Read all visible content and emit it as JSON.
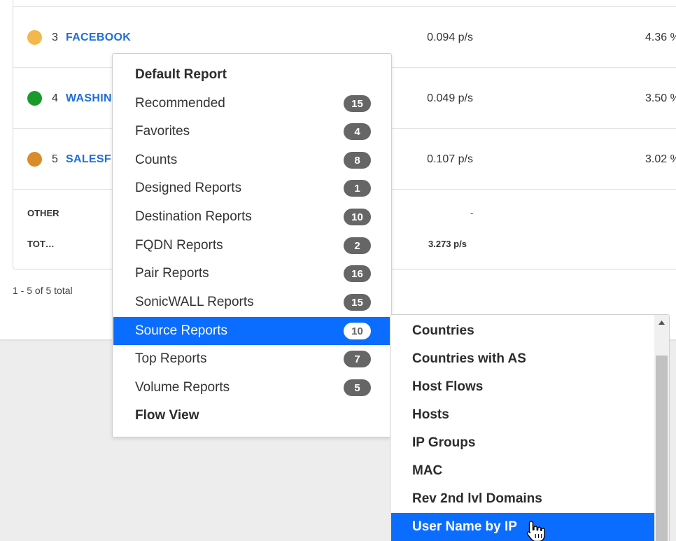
{
  "table": {
    "rows": [
      {
        "rank": "3",
        "name": "FACEBOOK",
        "rate": "0.094 p/s",
        "percent": "4.36 %",
        "dot_color": "#f2b84b"
      },
      {
        "rank": "4",
        "name": "WASHIN",
        "rate": "0.049 p/s",
        "percent": "3.50 %",
        "dot_color": "#1a9a2b"
      },
      {
        "rank": "5",
        "name": "SALESF",
        "rate": "0.107 p/s",
        "percent": "3.02 %",
        "dot_color": "#d98c2b"
      }
    ],
    "other_label": "OTHER",
    "other_rate": "-",
    "total_label": "TOT…",
    "total_rate": "3.273 p/s",
    "footer": "1 - 5 of 5 total"
  },
  "menu": {
    "items": [
      {
        "label": "Default Report",
        "badge": null,
        "type": "header"
      },
      {
        "label": "Recommended",
        "badge": "15"
      },
      {
        "label": "Favorites",
        "badge": "4"
      },
      {
        "label": "Counts",
        "badge": "8"
      },
      {
        "label": "Designed Reports",
        "badge": "1"
      },
      {
        "label": "Destination Reports",
        "badge": "10"
      },
      {
        "label": "FQDN Reports",
        "badge": "2"
      },
      {
        "label": "Pair Reports",
        "badge": "16"
      },
      {
        "label": "SonicWALL Reports",
        "badge": "15"
      },
      {
        "label": "Source Reports",
        "badge": "10",
        "active": true
      },
      {
        "label": "Top Reports",
        "badge": "7"
      },
      {
        "label": "Volume Reports",
        "badge": "5"
      },
      {
        "label": "Flow View",
        "badge": null,
        "type": "header"
      }
    ]
  },
  "submenu": {
    "items": [
      {
        "label": "Countries"
      },
      {
        "label": "Countries with AS"
      },
      {
        "label": "Host Flows"
      },
      {
        "label": "Hosts"
      },
      {
        "label": "IP Groups"
      },
      {
        "label": "MAC"
      },
      {
        "label": "Rev 2nd lvl Domains"
      },
      {
        "label": "User Name by IP",
        "active": true
      }
    ]
  },
  "colors": {
    "accent": "#0a6dff",
    "link": "#1f6fd9",
    "badge": "#666666"
  }
}
